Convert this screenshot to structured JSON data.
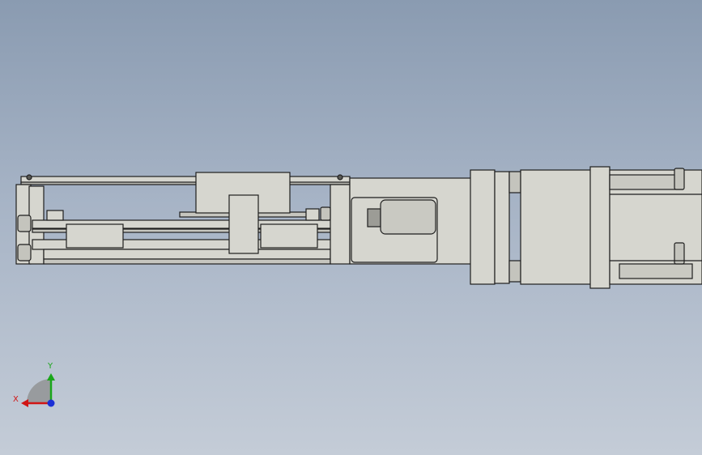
{
  "viewport": {
    "background_top": "#8a9bb1",
    "background_bottom": "#c4ccd7"
  },
  "model": {
    "part_fill": "#d6d6cf",
    "part_stroke": "#1e1e1e",
    "shadow_fill": "#b9b9b2"
  },
  "triad": {
    "x_label": "X",
    "y_label": "Y",
    "x_color": "#d01515",
    "y_color": "#1aa61a",
    "z_color": "#1a2fd6"
  }
}
